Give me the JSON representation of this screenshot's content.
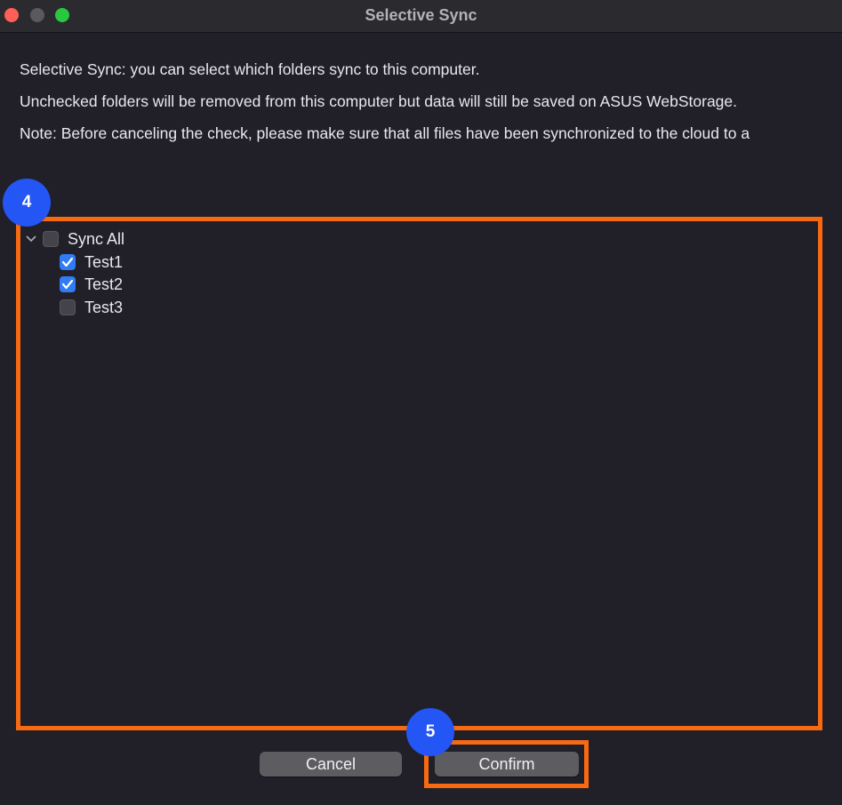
{
  "window": {
    "title": "Selective Sync"
  },
  "description": {
    "line1": "Selective Sync: you can select which folders sync to this computer.",
    "line2": "Unchecked folders will be removed from this computer but data will still be saved on ASUS WebStorage.",
    "line3": "Note: Before canceling the check, please make sure that all files have been synchronized to the cloud to a"
  },
  "tree": {
    "root": {
      "label": "Sync All",
      "checked": false,
      "expanded": true
    },
    "items": [
      {
        "label": "Test1",
        "checked": true
      },
      {
        "label": "Test2",
        "checked": true
      },
      {
        "label": "Test3",
        "checked": false
      }
    ]
  },
  "buttons": {
    "cancel_label": "Cancel",
    "confirm_label": "Confirm"
  },
  "annotations": {
    "step_folders": "4",
    "step_confirm": "5"
  },
  "colors": {
    "highlight": "#f76a12",
    "badge": "#2456f5",
    "checkbox_checked": "#2f7cf6"
  }
}
